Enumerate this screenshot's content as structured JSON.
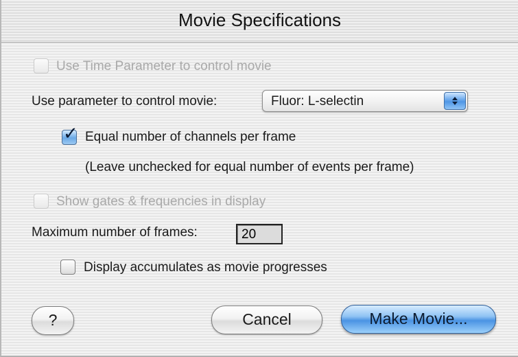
{
  "window": {
    "title": "Movie Specifications"
  },
  "options": {
    "use_time_parameter": {
      "label": "Use Time Parameter to control movie",
      "checked": false,
      "enabled": false
    },
    "parameter_select": {
      "label": "Use parameter to control movie:",
      "selected": "Fluor: L-selectin"
    },
    "equal_channels": {
      "label": "Equal number of channels per frame",
      "checked": true,
      "enabled": true
    },
    "equal_channels_hint": "(Leave unchecked for equal number of events per frame)",
    "show_gates": {
      "label": "Show gates & frequencies in display",
      "checked": false,
      "enabled": false
    },
    "max_frames": {
      "label": "Maximum number of frames:",
      "value": "20"
    },
    "display_accumulates": {
      "label": "Display accumulates as movie progresses",
      "checked": false,
      "enabled": true
    }
  },
  "buttons": {
    "help": "?",
    "cancel": "Cancel",
    "make_movie": "Make Movie..."
  },
  "icons": {
    "check": "checkmark-icon",
    "popup_arrows": "updown-arrows-icon"
  },
  "colors": {
    "accent": "#4a93e3",
    "disabled_text": "#a9a9a9"
  }
}
